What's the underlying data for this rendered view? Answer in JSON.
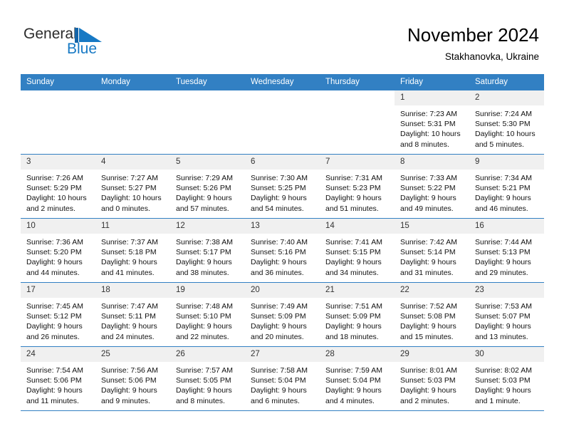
{
  "brand": {
    "line1": "General",
    "line2": "Blue",
    "flag_icon": "triangle-flag-icon",
    "accent_color": "#1779c4"
  },
  "header": {
    "title": "November 2024",
    "subtitle": "Stakhanovka, Ukraine"
  },
  "theme": {
    "header_bg": "#3280c3",
    "header_text": "#ffffff",
    "daynum_bg": "#f0f0f0",
    "cell_bg": "#ffffff",
    "row_divider": "#3280c3"
  },
  "weekdays": [
    "Sunday",
    "Monday",
    "Tuesday",
    "Wednesday",
    "Thursday",
    "Friday",
    "Saturday"
  ],
  "weeks": [
    [
      {
        "empty": true,
        "day": "",
        "sunrise": "",
        "sunset": "",
        "daylight1": "",
        "daylight2": ""
      },
      {
        "empty": true,
        "day": "",
        "sunrise": "",
        "sunset": "",
        "daylight1": "",
        "daylight2": ""
      },
      {
        "empty": true,
        "day": "",
        "sunrise": "",
        "sunset": "",
        "daylight1": "",
        "daylight2": ""
      },
      {
        "empty": true,
        "day": "",
        "sunrise": "",
        "sunset": "",
        "daylight1": "",
        "daylight2": ""
      },
      {
        "empty": true,
        "day": "",
        "sunrise": "",
        "sunset": "",
        "daylight1": "",
        "daylight2": ""
      },
      {
        "empty": false,
        "day": "1",
        "sunrise": "Sunrise: 7:23 AM",
        "sunset": "Sunset: 5:31 PM",
        "daylight1": "Daylight: 10 hours",
        "daylight2": "and 8 minutes."
      },
      {
        "empty": false,
        "day": "2",
        "sunrise": "Sunrise: 7:24 AM",
        "sunset": "Sunset: 5:30 PM",
        "daylight1": "Daylight: 10 hours",
        "daylight2": "and 5 minutes."
      }
    ],
    [
      {
        "empty": false,
        "day": "3",
        "sunrise": "Sunrise: 7:26 AM",
        "sunset": "Sunset: 5:29 PM",
        "daylight1": "Daylight: 10 hours",
        "daylight2": "and 2 minutes."
      },
      {
        "empty": false,
        "day": "4",
        "sunrise": "Sunrise: 7:27 AM",
        "sunset": "Sunset: 5:27 PM",
        "daylight1": "Daylight: 10 hours",
        "daylight2": "and 0 minutes."
      },
      {
        "empty": false,
        "day": "5",
        "sunrise": "Sunrise: 7:29 AM",
        "sunset": "Sunset: 5:26 PM",
        "daylight1": "Daylight: 9 hours",
        "daylight2": "and 57 minutes."
      },
      {
        "empty": false,
        "day": "6",
        "sunrise": "Sunrise: 7:30 AM",
        "sunset": "Sunset: 5:25 PM",
        "daylight1": "Daylight: 9 hours",
        "daylight2": "and 54 minutes."
      },
      {
        "empty": false,
        "day": "7",
        "sunrise": "Sunrise: 7:31 AM",
        "sunset": "Sunset: 5:23 PM",
        "daylight1": "Daylight: 9 hours",
        "daylight2": "and 51 minutes."
      },
      {
        "empty": false,
        "day": "8",
        "sunrise": "Sunrise: 7:33 AM",
        "sunset": "Sunset: 5:22 PM",
        "daylight1": "Daylight: 9 hours",
        "daylight2": "and 49 minutes."
      },
      {
        "empty": false,
        "day": "9",
        "sunrise": "Sunrise: 7:34 AM",
        "sunset": "Sunset: 5:21 PM",
        "daylight1": "Daylight: 9 hours",
        "daylight2": "and 46 minutes."
      }
    ],
    [
      {
        "empty": false,
        "day": "10",
        "sunrise": "Sunrise: 7:36 AM",
        "sunset": "Sunset: 5:20 PM",
        "daylight1": "Daylight: 9 hours",
        "daylight2": "and 44 minutes."
      },
      {
        "empty": false,
        "day": "11",
        "sunrise": "Sunrise: 7:37 AM",
        "sunset": "Sunset: 5:18 PM",
        "daylight1": "Daylight: 9 hours",
        "daylight2": "and 41 minutes."
      },
      {
        "empty": false,
        "day": "12",
        "sunrise": "Sunrise: 7:38 AM",
        "sunset": "Sunset: 5:17 PM",
        "daylight1": "Daylight: 9 hours",
        "daylight2": "and 38 minutes."
      },
      {
        "empty": false,
        "day": "13",
        "sunrise": "Sunrise: 7:40 AM",
        "sunset": "Sunset: 5:16 PM",
        "daylight1": "Daylight: 9 hours",
        "daylight2": "and 36 minutes."
      },
      {
        "empty": false,
        "day": "14",
        "sunrise": "Sunrise: 7:41 AM",
        "sunset": "Sunset: 5:15 PM",
        "daylight1": "Daylight: 9 hours",
        "daylight2": "and 34 minutes."
      },
      {
        "empty": false,
        "day": "15",
        "sunrise": "Sunrise: 7:42 AM",
        "sunset": "Sunset: 5:14 PM",
        "daylight1": "Daylight: 9 hours",
        "daylight2": "and 31 minutes."
      },
      {
        "empty": false,
        "day": "16",
        "sunrise": "Sunrise: 7:44 AM",
        "sunset": "Sunset: 5:13 PM",
        "daylight1": "Daylight: 9 hours",
        "daylight2": "and 29 minutes."
      }
    ],
    [
      {
        "empty": false,
        "day": "17",
        "sunrise": "Sunrise: 7:45 AM",
        "sunset": "Sunset: 5:12 PM",
        "daylight1": "Daylight: 9 hours",
        "daylight2": "and 26 minutes."
      },
      {
        "empty": false,
        "day": "18",
        "sunrise": "Sunrise: 7:47 AM",
        "sunset": "Sunset: 5:11 PM",
        "daylight1": "Daylight: 9 hours",
        "daylight2": "and 24 minutes."
      },
      {
        "empty": false,
        "day": "19",
        "sunrise": "Sunrise: 7:48 AM",
        "sunset": "Sunset: 5:10 PM",
        "daylight1": "Daylight: 9 hours",
        "daylight2": "and 22 minutes."
      },
      {
        "empty": false,
        "day": "20",
        "sunrise": "Sunrise: 7:49 AM",
        "sunset": "Sunset: 5:09 PM",
        "daylight1": "Daylight: 9 hours",
        "daylight2": "and 20 minutes."
      },
      {
        "empty": false,
        "day": "21",
        "sunrise": "Sunrise: 7:51 AM",
        "sunset": "Sunset: 5:09 PM",
        "daylight1": "Daylight: 9 hours",
        "daylight2": "and 18 minutes."
      },
      {
        "empty": false,
        "day": "22",
        "sunrise": "Sunrise: 7:52 AM",
        "sunset": "Sunset: 5:08 PM",
        "daylight1": "Daylight: 9 hours",
        "daylight2": "and 15 minutes."
      },
      {
        "empty": false,
        "day": "23",
        "sunrise": "Sunrise: 7:53 AM",
        "sunset": "Sunset: 5:07 PM",
        "daylight1": "Daylight: 9 hours",
        "daylight2": "and 13 minutes."
      }
    ],
    [
      {
        "empty": false,
        "day": "24",
        "sunrise": "Sunrise: 7:54 AM",
        "sunset": "Sunset: 5:06 PM",
        "daylight1": "Daylight: 9 hours",
        "daylight2": "and 11 minutes."
      },
      {
        "empty": false,
        "day": "25",
        "sunrise": "Sunrise: 7:56 AM",
        "sunset": "Sunset: 5:06 PM",
        "daylight1": "Daylight: 9 hours",
        "daylight2": "and 9 minutes."
      },
      {
        "empty": false,
        "day": "26",
        "sunrise": "Sunrise: 7:57 AM",
        "sunset": "Sunset: 5:05 PM",
        "daylight1": "Daylight: 9 hours",
        "daylight2": "and 8 minutes."
      },
      {
        "empty": false,
        "day": "27",
        "sunrise": "Sunrise: 7:58 AM",
        "sunset": "Sunset: 5:04 PM",
        "daylight1": "Daylight: 9 hours",
        "daylight2": "and 6 minutes."
      },
      {
        "empty": false,
        "day": "28",
        "sunrise": "Sunrise: 7:59 AM",
        "sunset": "Sunset: 5:04 PM",
        "daylight1": "Daylight: 9 hours",
        "daylight2": "and 4 minutes."
      },
      {
        "empty": false,
        "day": "29",
        "sunrise": "Sunrise: 8:01 AM",
        "sunset": "Sunset: 5:03 PM",
        "daylight1": "Daylight: 9 hours",
        "daylight2": "and 2 minutes."
      },
      {
        "empty": false,
        "day": "30",
        "sunrise": "Sunrise: 8:02 AM",
        "sunset": "Sunset: 5:03 PM",
        "daylight1": "Daylight: 9 hours",
        "daylight2": "and 1 minute."
      }
    ]
  ]
}
